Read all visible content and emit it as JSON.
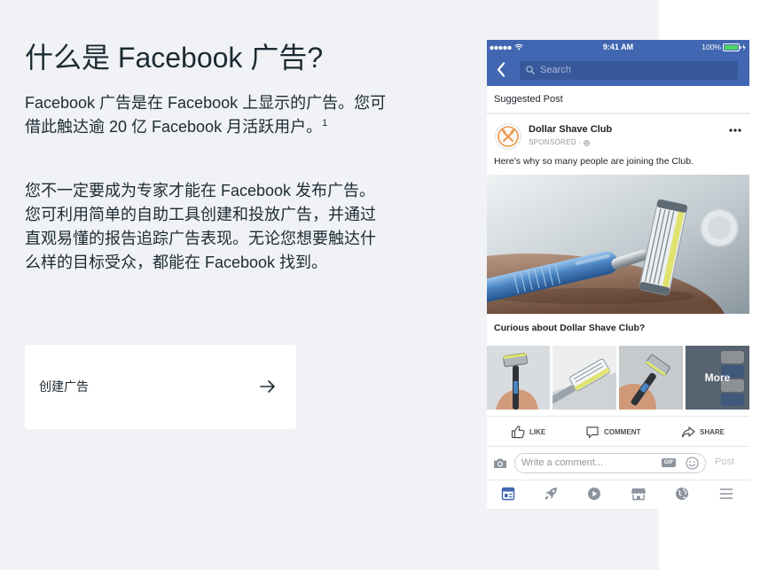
{
  "colors": {
    "page_background": "#f0f2f5",
    "text_primary": "#1c2b33",
    "facebook_blue": "#4267b2",
    "muted_text": "#90949c",
    "battery_green": "#4cd964",
    "logo_orange": "#e8974a"
  },
  "header": {
    "title": "什么是 Facebook 广告?"
  },
  "intro": {
    "paragraph_1": "Facebook 广告是在 Facebook 上显示的广告。您可借此触达逾 20 亿 Facebook 月活跃用户。",
    "footnote_marker": "1",
    "paragraph_2": "您不一定要成为专家才能在 Facebook 发布广告。您可利用简单的自助工具创建和投放广告，并通过直观易懂的报告追踪广告表现。无论您想要触达什么样的目标受众，都能在 Facebook 找到。"
  },
  "cta": {
    "label": "创建广告",
    "icon": "arrow-right-icon"
  },
  "phone_mockup": {
    "status_bar": {
      "signal_icon": "signal-dots-icon",
      "wifi_icon": "wifi-icon",
      "time": "9:41 AM",
      "battery_percent": "100%",
      "battery_icon": "battery-charging-icon"
    },
    "nav_bar": {
      "back_icon": "chevron-left-icon",
      "search_icon": "search-icon",
      "search_placeholder": "Search"
    },
    "feed": {
      "section_label": "Suggested Post",
      "post": {
        "author": "Dollar Shave Club",
        "avatar_icon": "brand-logo-icon",
        "sponsored_label": "SPONSORED ·",
        "audience_icon": "globe-icon",
        "more_icon": "more-options-icon",
        "text": "Here's why so many people are joining the Club.",
        "headline": "Curious about Dollar Shave Club?",
        "carousel_more_label": "More",
        "actions": [
          {
            "label": "LIKE",
            "icon": "thumbs-up-icon"
          },
          {
            "label": "COMMENT",
            "icon": "comment-icon"
          },
          {
            "label": "SHARE",
            "icon": "share-icon"
          }
        ]
      },
      "comment_composer": {
        "camera_icon": "camera-icon",
        "placeholder": "Write a comment...",
        "gif_label": "GIF",
        "emoji_icon": "smiley-icon",
        "post_label": "Post"
      }
    },
    "tab_bar": [
      {
        "icon": "news-feed-icon",
        "active": true
      },
      {
        "icon": "rocket-icon",
        "active": false
      },
      {
        "icon": "video-play-icon",
        "active": false
      },
      {
        "icon": "marketplace-icon",
        "active": false
      },
      {
        "icon": "globe-icon",
        "active": false
      },
      {
        "icon": "menu-icon",
        "active": false
      }
    ]
  }
}
